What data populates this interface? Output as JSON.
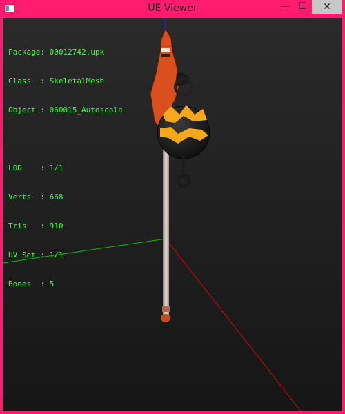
{
  "window": {
    "title": "UE Viewer",
    "controls": {
      "minimize": "—",
      "maximize": "☐",
      "close": "✕"
    }
  },
  "info": {
    "package_label": "Package:",
    "package_value": "00012742.upk",
    "class_label": "Class  :",
    "class_value": "SkeletalMesh",
    "object_label": "Object :",
    "object_value": "060015_Autoscale",
    "lod_label": "LOD    :",
    "lod_value": "1/1",
    "verts_label": "Verts  :",
    "verts_value": "668",
    "tris_label": "Tris   :",
    "tris_value": "910",
    "uvset_label": "UV Set :",
    "uvset_value": "1/1",
    "bones_label": "Bones  :",
    "bones_value": "5"
  },
  "colors": {
    "frame": "#ff1c6f",
    "info_text": "#3cff3c",
    "axis_x": "#e00000",
    "axis_y": "#00c000",
    "axis_z": "#2020ff"
  }
}
